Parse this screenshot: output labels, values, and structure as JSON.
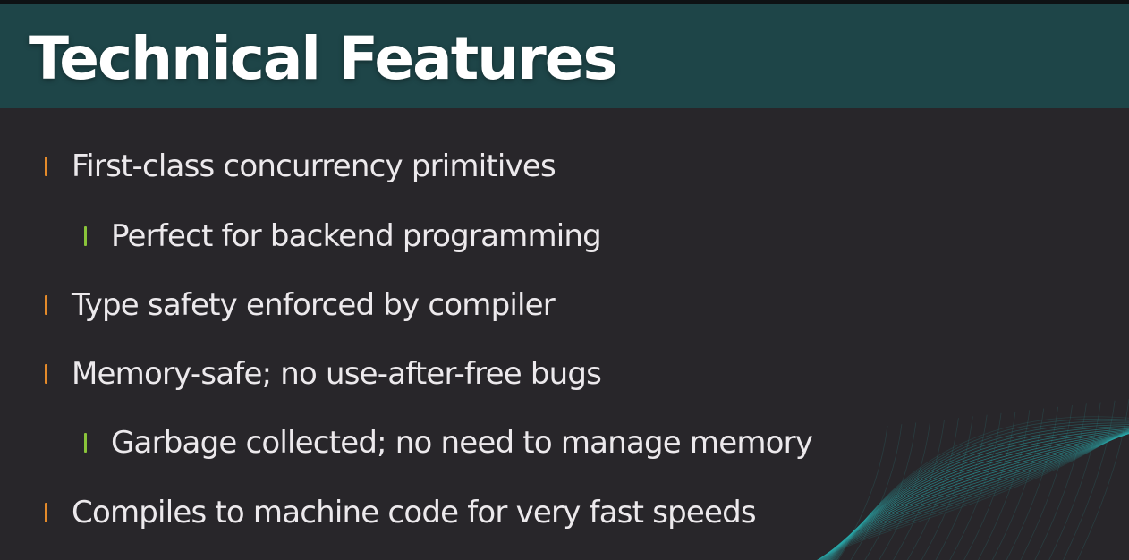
{
  "slide": {
    "title": "Technical Features",
    "bullets": [
      {
        "text": "First-class concurrency primitives",
        "level": 1
      },
      {
        "text": "Perfect for backend programming",
        "level": 2
      },
      {
        "text": "Type safety enforced by compiler",
        "level": 1
      },
      {
        "text": "Memory-safe; no use-after-free bugs",
        "level": 1
      },
      {
        "text": "Garbage collected; no need to manage memory",
        "level": 2
      },
      {
        "text": "Compiles to machine code for very fast speeds",
        "level": 1
      }
    ]
  },
  "colors": {
    "header_bg": "#1e4548",
    "body_bg": "#28262a",
    "text": "#ece9ec",
    "marker_level1": "#e48a2a",
    "marker_level2": "#8ac43a",
    "wave": "#2aa7a8"
  },
  "icons": {
    "decoration": "wave-mesh-graphic"
  }
}
